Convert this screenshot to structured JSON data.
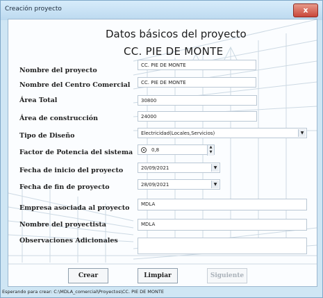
{
  "window": {
    "title": "Creación proyecto",
    "close_glyph": "x"
  },
  "header": {
    "line1": "Datos básicos del proyecto",
    "line2": "CC. PIE DE MONTE"
  },
  "fields": [
    {
      "label": "Nombre del proyecto",
      "value": "CC. PIE DE MONTE"
    },
    {
      "label": "Nombre del Centro Comercial",
      "value": "CC. PIE DE MONTE"
    },
    {
      "label": "Área Total",
      "value": "30800"
    },
    {
      "label": "Área de construcción",
      "value": "24000"
    },
    {
      "label": "Tipo de Diseño",
      "value": "Electricidad(Locales,Servicios)"
    },
    {
      "label": "Factor de Potencia del sistema",
      "value": "0,8"
    },
    {
      "label": "Fecha de inicio del proyecto",
      "value": "20/09/2021"
    },
    {
      "label": "Fecha de fin de proyecto",
      "value": "28/09/2021"
    },
    {
      "label": "Empresa asociada al proyecto",
      "value": "MDLA"
    },
    {
      "label": "Nombre del proyectista",
      "value": "MDLA"
    },
    {
      "label": "Observaciones Adicionales",
      "value": ""
    }
  ],
  "buttons": {
    "create": "Crear",
    "clear": "Limpiar",
    "next": "Siguiente"
  },
  "statusbar": {
    "text": "Esperando para crear: C:\\MDLA_comercial\\Proyectos\\CC. PIE DE MONTE"
  },
  "icons": {
    "close": "close-icon",
    "dropdown": "chevron-down-icon",
    "radio": "radio-icon",
    "spin": "spinner-icon"
  },
  "colors": {
    "window_bg": "#cfe6f4",
    "close_button": "#c9473a",
    "form_bg": "#fbfdff"
  }
}
